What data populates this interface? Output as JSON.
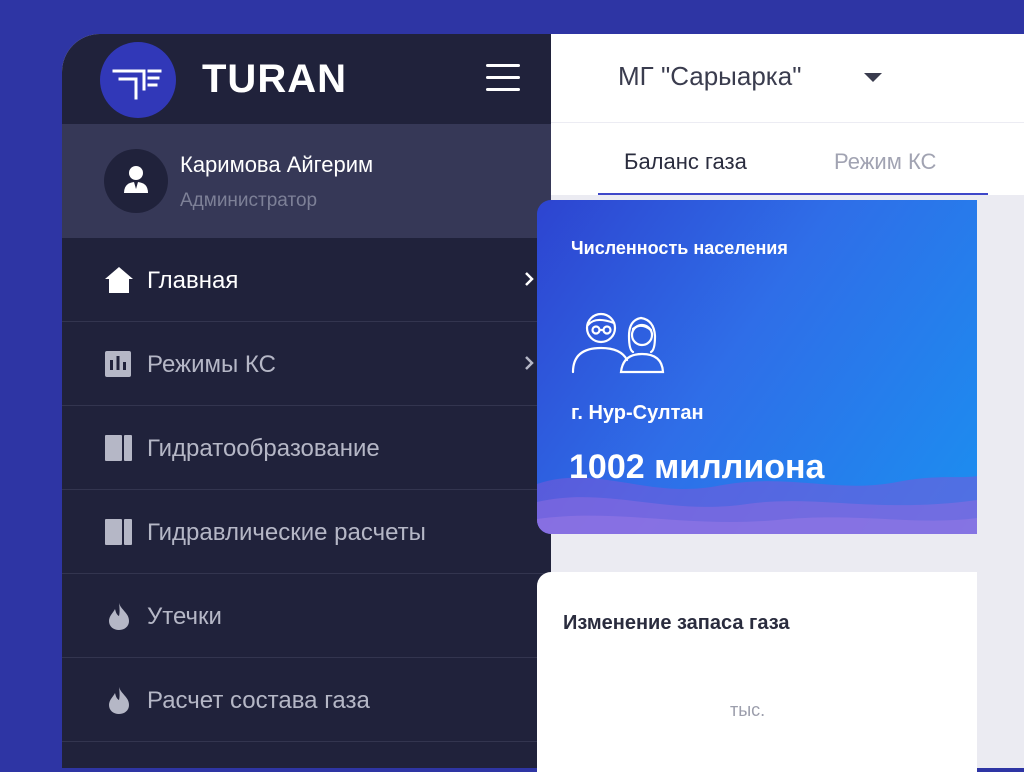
{
  "brand": {
    "name": "TURAN",
    "logo_icon": "turan-logo-icon",
    "menu_icon": "hamburger-menu-icon"
  },
  "user": {
    "name": "Каримова Айгерим",
    "role": "Администратор",
    "avatar_icon": "user-avatar-icon"
  },
  "sidebar": {
    "items": [
      {
        "label": "Главная",
        "icon": "home-icon",
        "has_submenu": true,
        "active": true
      },
      {
        "label": "Режимы КС",
        "icon": "bar-chart-icon",
        "has_submenu": true,
        "active": false
      },
      {
        "label": "Гидратообразование",
        "icon": "document-icon",
        "has_submenu": false,
        "active": false
      },
      {
        "label": "Гидравлические расчеты",
        "icon": "document-icon",
        "has_submenu": false,
        "active": false
      },
      {
        "label": "Утечки",
        "icon": "flame-icon",
        "has_submenu": false,
        "active": false
      },
      {
        "label": "Расчет состава газа",
        "icon": "flame-icon",
        "has_submenu": false,
        "active": false
      }
    ]
  },
  "header": {
    "region": "МГ \"Сарыарка\""
  },
  "tabs": [
    {
      "label": "Баланс газа",
      "active": true
    },
    {
      "label": "Режим КС",
      "active": false
    }
  ],
  "population_card": {
    "title": "Численность населения",
    "icon": "people-icon",
    "city": "г. Нур-Султан",
    "value": "1002 миллиона"
  },
  "gas_stock_card": {
    "title": "Изменение запаса газа",
    "unit": "тыс."
  },
  "colors": {
    "background": "#2e35a4",
    "sidebar": "#20223b",
    "sidebar_user": "#363857",
    "accent": "#3e47c9",
    "card_gradient_start": "#2d44d0",
    "card_gradient_end": "#1b8ff0"
  }
}
